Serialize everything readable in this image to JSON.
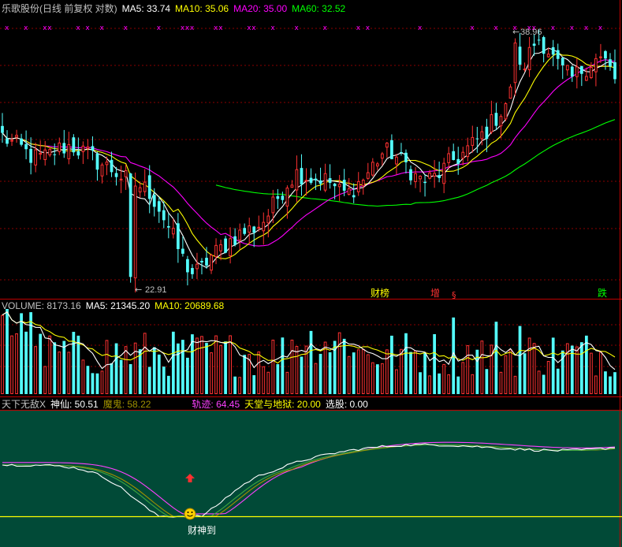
{
  "colors": {
    "background": "#000000",
    "up": "#ff3232",
    "down": "#54ffff",
    "grid": "#8b0000",
    "ma5": "#ffffff",
    "ma10": "#ffff00",
    "ma20": "#ff00ff",
    "ma60": "#00ff00",
    "osc_bg": "#014a37",
    "white_line": "#ffffff",
    "green_line": "#3fa63f",
    "olive_line": "#a09000",
    "magenta_line": "#ff40ff",
    "yellow_line": "#ffff00"
  },
  "price_panel": {
    "title": "乐歌股份(日线 前复权 对数)",
    "ma5_label": "MA5: 33.74",
    "ma10_label": "MA10: 35.06",
    "ma20_label": "MA20: 35.00",
    "ma60_label": "MA60: 32.52",
    "high_label": "38.96",
    "low_label": "22.91",
    "signals": [
      "财榜",
      "增",
      "跌"
    ],
    "top_markers": "x"
  },
  "volume_panel": {
    "volume_label": "VOLUME: 8173.16",
    "ma5_label": "MA5: 21345.20",
    "ma10_label": "MA10: 20689.68"
  },
  "osc_panel": {
    "name_label": "天下无敌X",
    "shenxian_label": "神仙: 50.51",
    "mogui_label": "魔鬼: 58.22",
    "guiji_label": "轨迹: 64.45",
    "tiantang_label": "天堂与地狱: 20.00",
    "xuangu_label": "选股: 0.00",
    "annotation": "财神到"
  },
  "chart_data": {
    "type": "candlestick",
    "scale": "log",
    "close_trend": [
      31.2,
      30.8,
      30.5,
      30.0,
      29.8,
      29.9,
      30.2,
      30.5,
      30.6,
      30.3,
      30.0,
      29.6,
      29.3,
      29.0,
      28.6,
      28.3,
      28.1,
      27.8,
      27.0,
      26.0,
      25.0,
      24.0,
      23.4,
      23.5,
      24.2,
      24.5,
      24.9,
      25.3,
      25.5,
      25.7,
      26.0,
      26.6,
      27.5,
      28.3,
      28.9,
      28.8,
      28.5,
      28.6,
      28.3,
      27.8,
      27.6,
      28.2,
      28.6,
      29.4,
      30.1,
      30.2,
      29.7,
      29.3,
      28.6,
      28.4,
      28.6,
      29.0,
      29.6,
      29.9,
      30.4,
      30.9,
      31.5,
      32.3,
      33.1,
      34.3,
      35.7,
      37.0,
      38.4,
      37.8,
      36.5,
      35.7,
      35.2,
      35.8,
      36.4,
      36.8,
      36.4,
      35.2
    ],
    "high": 38.96,
    "low": 22.91,
    "signals": [
      "财榜",
      "增",
      "跌"
    ],
    "ma_values": {
      "MA5": 33.74,
      "MA10": 35.06,
      "MA20": 35.0,
      "MA60": 32.52
    },
    "volume_ma": {
      "VOLUME": 8173.16,
      "MA5": 21345.2,
      "MA10": 20689.68
    },
    "oscillator": {
      "神仙": 50.51,
      "魔鬼": 58.22,
      "轨迹": 64.45,
      "天堂与地狱": 20.0,
      "选股": 0.0
    }
  }
}
